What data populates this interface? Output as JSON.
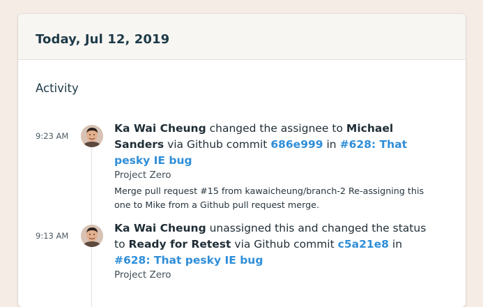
{
  "card": {
    "title": "Today, Jul 12, 2019"
  },
  "activity": {
    "heading": "Activity",
    "items": [
      {
        "time": "9:23 AM",
        "actor": "Ka Wai Cheung",
        "action": "changed the assignee to",
        "target": "Michael Sanders",
        "via": "via Github commit",
        "commit": "686e999",
        "in": "in",
        "issue": "#628: That pesky IE bug",
        "project": "Project Zero",
        "message": "Merge pull request #15 from kawaicheung/branch-2 Re-assigning this one to Mike from a Github pull request merge."
      },
      {
        "time": "9:13 AM",
        "actor": "Ka Wai Cheung",
        "action": "unassigned this and changed the status to",
        "target": "Ready for Retest",
        "via": "via Github commit",
        "commit": "c5a21e8",
        "in": "in",
        "issue": "#628: That pesky IE bug",
        "project": "Project Zero"
      }
    ]
  },
  "colors": {
    "background": "#f5ece6",
    "link": "#2f8ed8",
    "heading": "#1d3a48"
  },
  "icons": {
    "avatar": "user-avatar-icon"
  }
}
